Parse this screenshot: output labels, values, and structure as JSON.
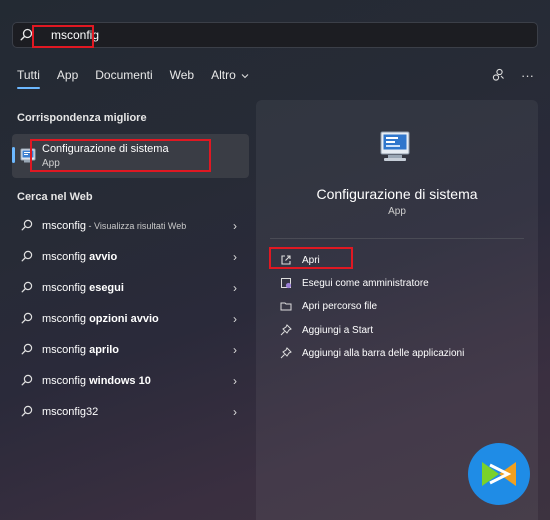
{
  "search": {
    "value": "msconfig",
    "placeholder": ""
  },
  "tabs": [
    {
      "label": "Tutti",
      "active": true
    },
    {
      "label": "App"
    },
    {
      "label": "Documenti"
    },
    {
      "label": "Web"
    },
    {
      "label": "Altro"
    }
  ],
  "toolbar": {
    "more_glyph": "···"
  },
  "best_match": {
    "section_label": "Corrispondenza migliore",
    "title": "Configurazione di sistema",
    "subtitle": "App"
  },
  "web": {
    "section_label": "Cerca nel Web",
    "items": [
      {
        "prefix": "msconfig",
        "bold": "",
        "extra": " - Visualizza risultati Web"
      },
      {
        "prefix": "msconfig ",
        "bold": "avvio",
        "extra": ""
      },
      {
        "prefix": "msconfig ",
        "bold": "esegui",
        "extra": ""
      },
      {
        "prefix": "msconfig ",
        "bold": "opzioni avvio",
        "extra": ""
      },
      {
        "prefix": "msconfig ",
        "bold": "aprilo",
        "extra": ""
      },
      {
        "prefix": "msconfig ",
        "bold": "windows 10",
        "extra": ""
      },
      {
        "prefix": "msconfig32",
        "bold": "",
        "extra": ""
      }
    ]
  },
  "details": {
    "title": "Configurazione di sistema",
    "subtitle": "App",
    "actions": [
      {
        "label": "Apri",
        "icon": "open-icon"
      },
      {
        "label": "Esegui come amministratore",
        "icon": "shield-icon"
      },
      {
        "label": "Apri percorso file",
        "icon": "folder-icon"
      },
      {
        "label": "Aggiungi a Start",
        "icon": "pin-icon"
      },
      {
        "label": "Aggiungi alla barra delle applicazioni",
        "icon": "pin-icon"
      }
    ]
  },
  "colors": {
    "accent": "#6cb8ff",
    "highlight": "#e01822",
    "logo": "#1f8ce6"
  }
}
